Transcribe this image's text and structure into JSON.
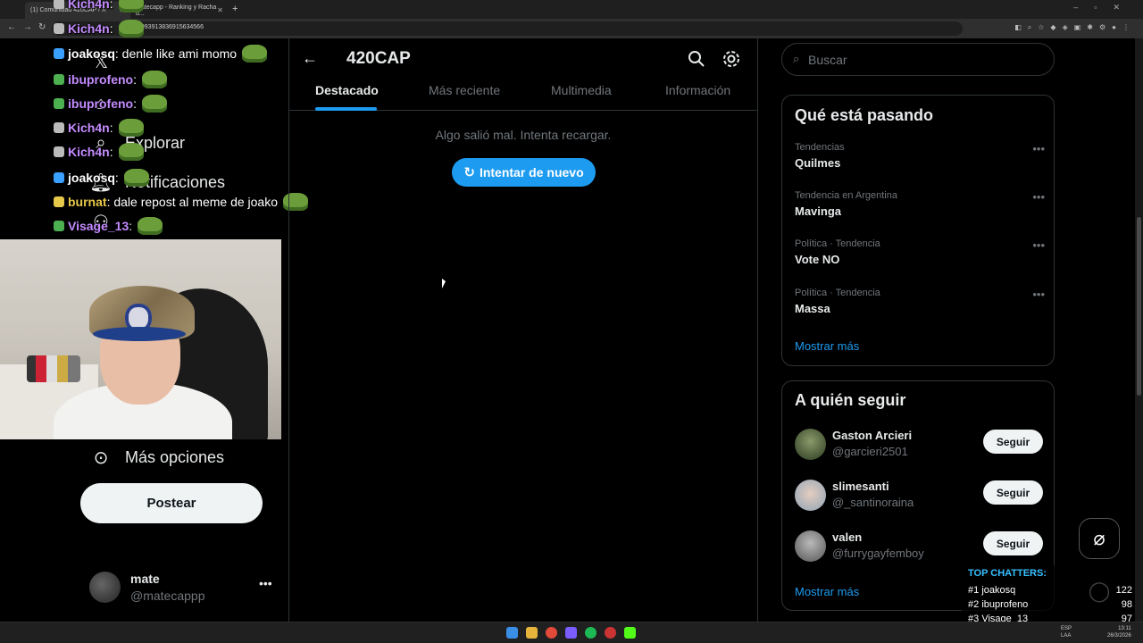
{
  "browser": {
    "tabs": [
      {
        "label": "(1) Comunidad 420CAP / X",
        "active": true
      },
      {
        "label": "Matecapp - Ranking y Racha d...",
        "active": false
      }
    ],
    "url": "1993913836915634566"
  },
  "leftnav": {
    "explore_label": "Explorar",
    "notifications_label": "Notificaciones",
    "more_options_label": "Más opciones",
    "post_button": "Postear",
    "account": {
      "name": "mate",
      "handle": "@matecappp"
    }
  },
  "chat": [
    {
      "user": "Kich4n",
      "message": ":",
      "color": "#c48bff",
      "badge": "#bbbbbb"
    },
    {
      "user": "Kich4n",
      "message": ":",
      "color": "#c48bff",
      "badge": "#bbbbbb"
    },
    {
      "user": "joakosq",
      "message": ": denle like ami momo",
      "color": "#ffffff",
      "badge": "#3aa0ff"
    },
    {
      "user": "ibuprofeno",
      "message": ":",
      "color": "#c48bff",
      "badge": "#4caf50"
    },
    {
      "user": "ibuprofeno",
      "message": ":",
      "color": "#c48bff",
      "badge": "#4caf50"
    },
    {
      "user": "Kich4n",
      "message": ":",
      "color": "#c48bff",
      "badge": "#bbbbbb"
    },
    {
      "user": "Kich4n",
      "message": ":",
      "color": "#c48bff",
      "badge": "#bbbbbb"
    },
    {
      "user": "joakosq",
      "message": ":",
      "color": "#ffffff",
      "badge": "#3aa0ff"
    },
    {
      "user": "burnat",
      "message": ": dale repost al meme de joako",
      "color": "#e6c84a",
      "badge": "#e6c84a"
    },
    {
      "user": "Visage_13",
      "message": ":",
      "color": "#c48bff",
      "badge": "#4caf50"
    }
  ],
  "main": {
    "title": "420CAP",
    "tabs": [
      "Destacado",
      "Más reciente",
      "Multimedia",
      "Información"
    ],
    "error": "Algo salió mal. Intenta recargar.",
    "retry": "Intentar de nuevo"
  },
  "sidebar": {
    "search_placeholder": "Buscar",
    "trends_title": "Qué está pasando",
    "trends": [
      {
        "context": "Tendencias",
        "name": "Quilmes"
      },
      {
        "context": "Tendencia en Argentina",
        "name": "Mavinga"
      },
      {
        "context": "Política · Tendencia",
        "name": "Vote NO"
      },
      {
        "context": "Política · Tendencia",
        "name": "Massa"
      }
    ],
    "show_more": "Mostrar más",
    "follow_title": "A quién seguir",
    "follow": [
      {
        "name": "Gaston Arcieri",
        "handle": "@garcieri2501",
        "button": "Seguir"
      },
      {
        "name": "slimesanti",
        "handle": "@_santinoraina",
        "button": "Seguir"
      },
      {
        "name": "valen",
        "handle": "@furrygayfemboy",
        "button": "Seguir"
      }
    ],
    "show_more_2": "Mostrar más"
  },
  "top_chatters": {
    "title": "TOP CHATTERS:",
    "rows": [
      {
        "rank": "#1",
        "user": "joakosq",
        "count": "122"
      },
      {
        "rank": "#2",
        "user": "ibuprofeno",
        "count": "98"
      },
      {
        "rank": "#3",
        "user": "Visage_13",
        "count": "97"
      }
    ]
  },
  "taskbar": {
    "lang": "ESP",
    "region": "LAA",
    "time": "13:11",
    "date": "26/3/2026"
  },
  "colors": {
    "accent": "#1d9bf0",
    "bg": "#000000",
    "border": "#2f3336"
  }
}
